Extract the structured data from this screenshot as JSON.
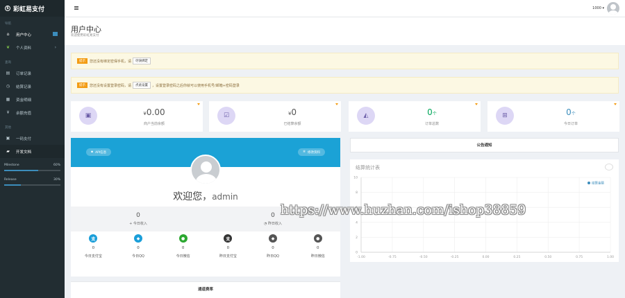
{
  "app": {
    "brand": "彩虹易支付",
    "brand_icon": "coin-icon"
  },
  "sidebar": {
    "sections": [
      "导航",
      "查询",
      "其他"
    ],
    "items": [
      {
        "label": "用户中心",
        "icon": "home-icon",
        "active": true
      },
      {
        "label": "个人资料",
        "icon": "leaf-icon",
        "has_arrow": true
      },
      {
        "label": "订单记录",
        "icon": "list-icon"
      },
      {
        "label": "结算记录",
        "icon": "clock-icon"
      },
      {
        "label": "资金明细",
        "icon": "table-icon"
      },
      {
        "label": "余额充值",
        "icon": "yen-icon"
      },
      {
        "label": "一码支付",
        "icon": "qrcode-icon"
      },
      {
        "label": "开发文档",
        "icon": "book-icon",
        "highlight": true
      }
    ],
    "progress": [
      {
        "label": "Milestone",
        "percent_text": "60%",
        "value": 0.6
      },
      {
        "label": "Release",
        "percent_text": "30%",
        "value": 0.3
      }
    ]
  },
  "topbar": {
    "user_id": "1000 ▾"
  },
  "header": {
    "title": "用户中心",
    "subtitle": "欢迎使用彩虹易支付"
  },
  "alerts": [
    {
      "tag": "提示",
      "text": "您还没有绑定密保手机，请",
      "button": "尽快绑定",
      "after": ""
    },
    {
      "tag": "提示",
      "text": "您还没有设置登录密码，请",
      "button": "点此设置",
      "after": "，设置登录密码之后你就可以使用手机号/邮箱+密码登录"
    }
  ],
  "stats": [
    {
      "prefix": "¥",
      "value": "0.00",
      "suffix": "",
      "label": "商户当前余额",
      "icon": "money-icon"
    },
    {
      "prefix": "¥",
      "value": "0",
      "suffix": "",
      "label": "已结算余额",
      "icon": "check-square-icon"
    },
    {
      "prefix": "",
      "value": "0",
      "suffix": "个",
      "label": "订单总数",
      "icon": "area-chart-icon"
    },
    {
      "prefix": "",
      "value": "0",
      "suffix": "个",
      "label": "今日订单",
      "icon": "cart-icon"
    }
  ],
  "profile": {
    "api_button": "API信息",
    "edit_button": "修改资料",
    "welcome": "欢迎您，",
    "username": "admin",
    "income": [
      {
        "value": "0",
        "label": "今日收入",
        "icon": "+"
      },
      {
        "value": "0",
        "label": "昨日收入",
        "icon": "◔"
      }
    ],
    "channels": [
      {
        "value": "0",
        "label": "今日支付宝",
        "icon": "alipay-icon",
        "glyph": "支",
        "color": "#1a9ed9"
      },
      {
        "value": "0",
        "label": "今日QQ",
        "icon": "qq-icon",
        "glyph": "◆",
        "color": "#1a9ed9"
      },
      {
        "value": "0",
        "label": "今日微信",
        "icon": "wechat-icon",
        "glyph": "●",
        "color": "#2ca831"
      },
      {
        "value": "0",
        "label": "昨日支付宝",
        "icon": "alipay-icon",
        "glyph": "支",
        "color": "#333333"
      },
      {
        "value": "0",
        "label": "昨日QQ",
        "icon": "qq-icon",
        "glyph": "◆",
        "color": "#555555"
      },
      {
        "value": "0",
        "label": "昨日微信",
        "icon": "wechat-icon",
        "glyph": "●",
        "color": "#555555"
      }
    ]
  },
  "rate_panel": {
    "title": "通道费率"
  },
  "notice": {
    "title": "公告通知"
  },
  "chart_data": {
    "type": "line",
    "title": "结算统计表",
    "legend": [
      "结算金额"
    ],
    "legend_placement": "top-right",
    "x_ticks": [
      "-1.00",
      "-0.75",
      "-0.50",
      "-0.25",
      "0.00",
      "0.25",
      "0.50",
      "0.75",
      "1.00"
    ],
    "y_ticks": [
      "10",
      "8",
      "6",
      "4",
      "2",
      "0"
    ],
    "xlim": [
      -1,
      1
    ],
    "ylim": [
      0,
      10
    ],
    "series": [
      {
        "name": "结算金额",
        "values": []
      }
    ],
    "grid": true,
    "colors": {
      "series": "#3c8dbc",
      "grid": "#eeeeee"
    }
  },
  "watermark": "https://www.huzhan.com/ishop38859"
}
